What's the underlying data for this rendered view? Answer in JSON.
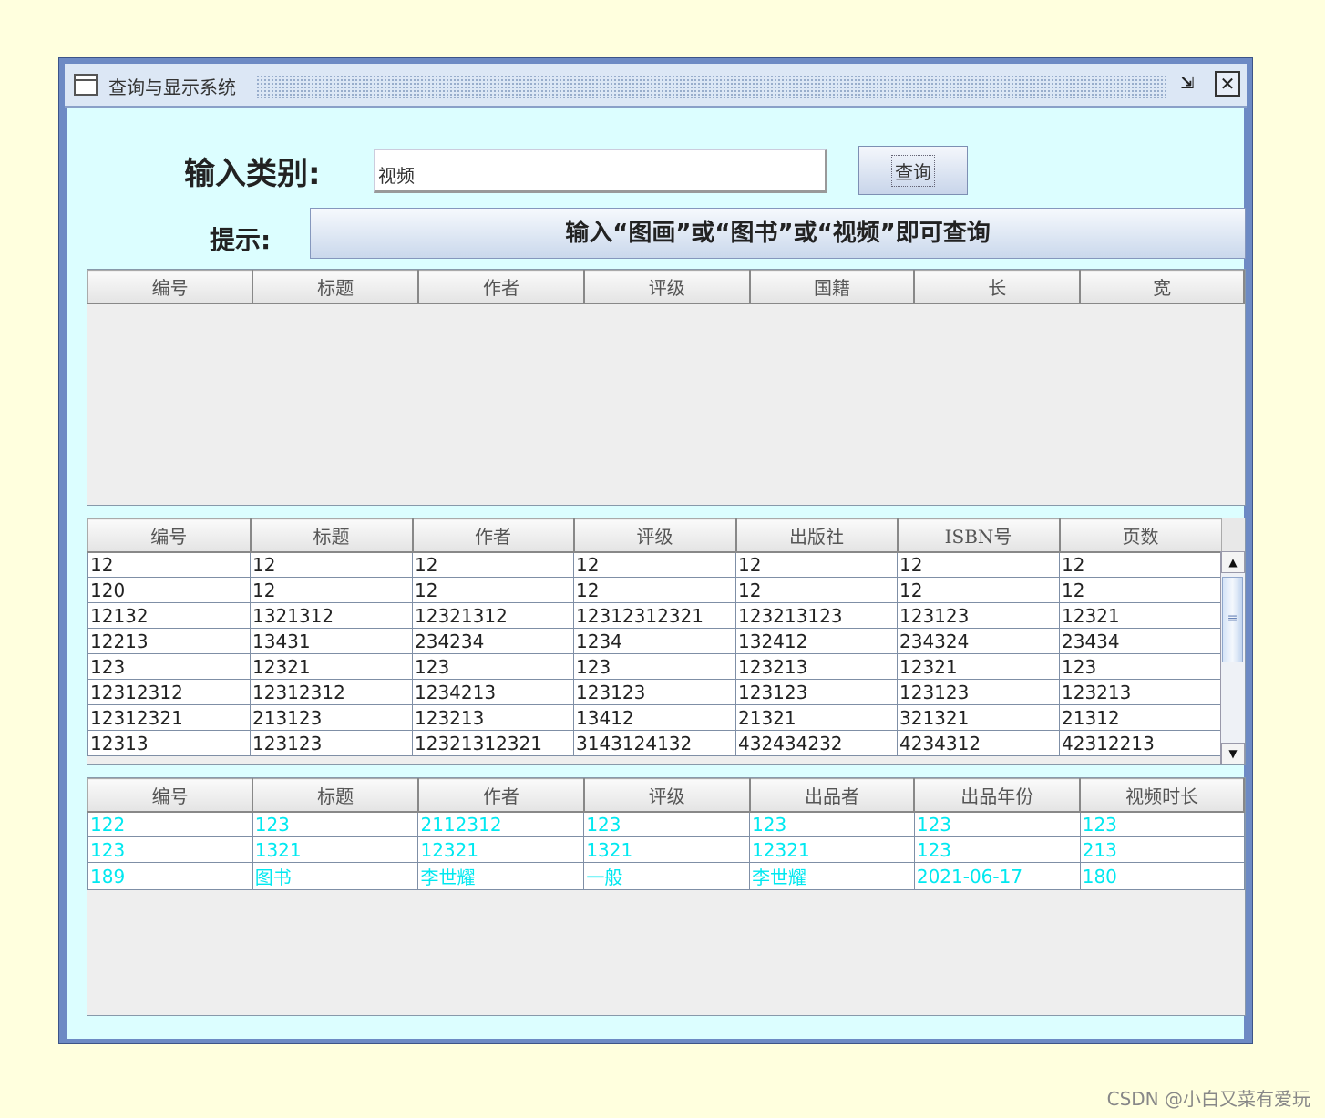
{
  "window": {
    "title": "查询与显示系统",
    "minimize_glyph": "⇲",
    "close_glyph": "✕"
  },
  "form": {
    "category_label": "输入类别:",
    "category_value": "视频",
    "query_button": "查询",
    "tip_label": "提示:",
    "tip_text": "输入“图画”或“图书”或“视频”即可查询"
  },
  "painting_table": {
    "columns": [
      "编号",
      "标题",
      "作者",
      "评级",
      "国籍",
      "长",
      "宽"
    ],
    "rows": []
  },
  "book_table": {
    "columns": [
      "编号",
      "标题",
      "作者",
      "评级",
      "出版社",
      "ISBN号",
      "页数"
    ],
    "rows": [
      [
        "12",
        "12",
        "12",
        "12",
        "12",
        "12",
        "12"
      ],
      [
        "120",
        "12",
        "12",
        "12",
        "12",
        "12",
        "12"
      ],
      [
        "12132",
        "1321312",
        "12321312",
        "12312312321",
        "123213123",
        "123123",
        "12321"
      ],
      [
        "12213",
        "13431",
        "234234",
        "1234",
        "132412",
        "234324",
        "23434"
      ],
      [
        "123",
        "12321",
        "123",
        "123",
        "123213",
        "12321",
        "123"
      ],
      [
        "12312312",
        "12312312",
        "1234213",
        "123123",
        "123123",
        "123123",
        "123213"
      ],
      [
        "12312321",
        "213123",
        "123213",
        "13412",
        "21321",
        "321321",
        "21312"
      ],
      [
        "12313",
        "123123",
        "12321312321",
        "3143124132",
        "432434232",
        "4234312",
        "42312213"
      ]
    ],
    "scroll_up_glyph": "▲",
    "scroll_down_glyph": "▼",
    "scroll_thumb_glyph": "≡"
  },
  "video_table": {
    "columns": [
      "编号",
      "标题",
      "作者",
      "评级",
      "出品者",
      "出品年份",
      "视频时长"
    ],
    "rows": [
      [
        "122",
        "123",
        "2112312",
        "123",
        "123",
        "123",
        "123"
      ],
      [
        "123",
        "1321",
        "12321",
        "1321",
        "12321",
        "123",
        "213"
      ],
      [
        "189",
        "图书",
        "李世耀",
        "一般",
        "李世耀",
        "2021-06-17",
        "180"
      ]
    ],
    "text_color": "#00e8f0"
  },
  "watermark": "CSDN @小白又菜有爱玩"
}
